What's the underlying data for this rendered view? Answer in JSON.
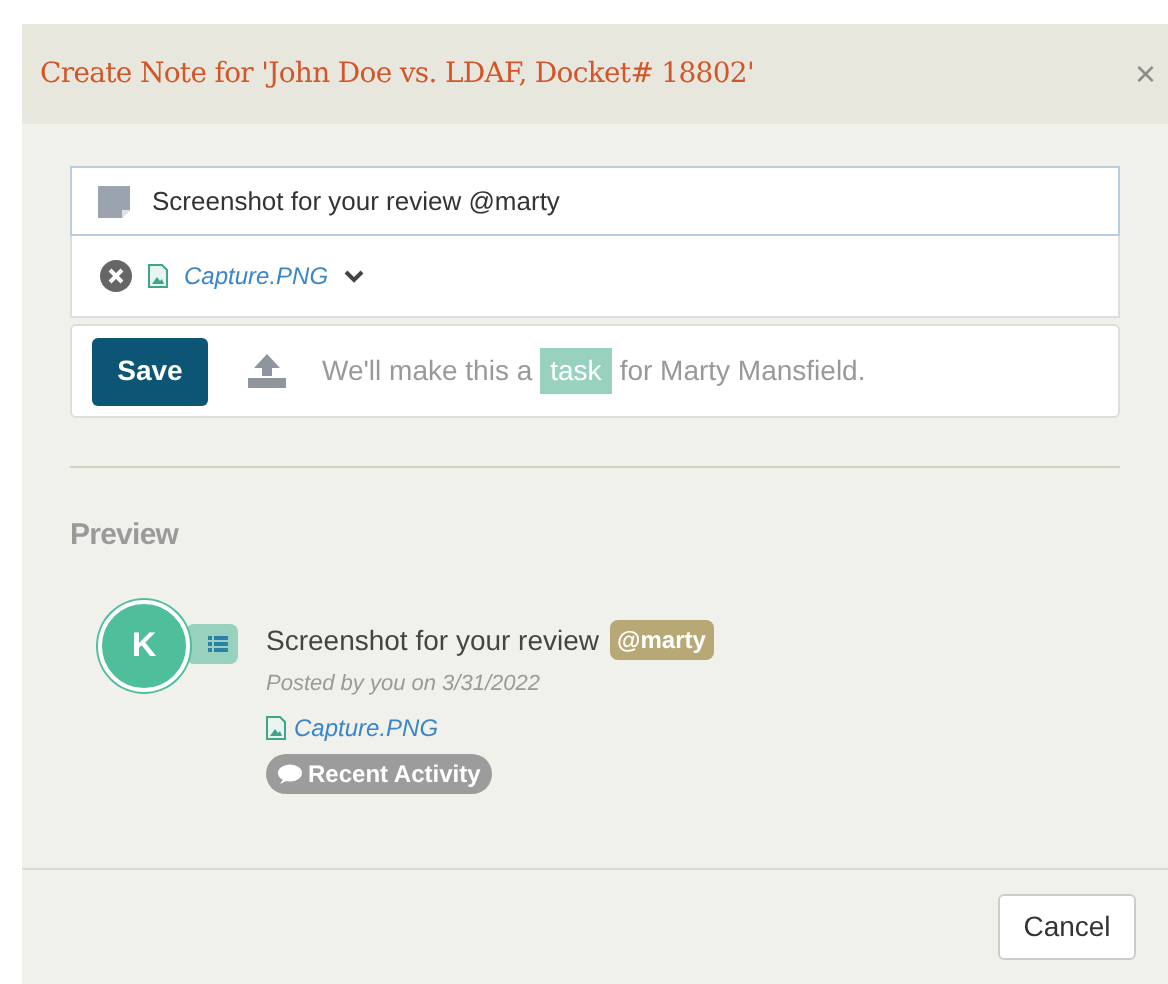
{
  "dialog": {
    "title": "Create Note for 'John Doe vs. LDAF, Docket# 18802'",
    "close": "×"
  },
  "note_field": {
    "value": "Screenshot for your review @marty"
  },
  "attachment": {
    "file": "Capture.PNG"
  },
  "save_row": {
    "button": "Save",
    "message_before": "We'll make this a",
    "task_tag": "task",
    "message_after": "for Marty Mansfield."
  },
  "preview": {
    "heading": "Preview",
    "avatar": "K",
    "title": "Screenshot for your review",
    "mention": "@marty",
    "posted": "Posted by you on 3/31/2022",
    "file": "Capture.PNG",
    "tag": "Recent Activity"
  },
  "footer": {
    "button": "Cancel"
  }
}
